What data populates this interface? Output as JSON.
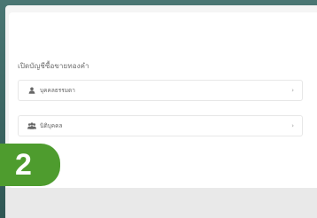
{
  "heading": "เปิดบัญชีซื้อขายทองคำ",
  "rows": [
    {
      "icon": "person-icon",
      "label": "บุคคลธรรมดา",
      "chevron": "›"
    },
    {
      "icon": "group-icon",
      "label": "นิติบุคคล",
      "chevron": "›"
    }
  ],
  "step_badge": "2",
  "colors": {
    "badge": "#4e9c2e",
    "background": "#3d6b68"
  }
}
